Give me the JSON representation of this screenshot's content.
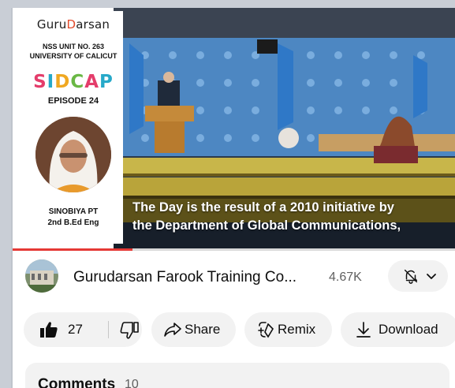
{
  "thumbnail": {
    "brand_prefix": "Guru",
    "brand_dot": "D",
    "brand_suffix": "arsan",
    "unit": "NSS UNIT NO. 263",
    "university": "UNIVERSITY OF CALICUT",
    "series_letters": [
      "S",
      "I",
      "D",
      "C",
      "A",
      "P"
    ],
    "episode": "EPISODE 24",
    "presenter_name": "SINOBIYA PT",
    "presenter_class": "2nd B.Ed Eng"
  },
  "video": {
    "caption_line1": "The Day is the result of a 2010 initiative by",
    "caption_line2": "the Department of Global Communications,",
    "progress": 0.27
  },
  "channel": {
    "name": "Gurudarsan Farook Training Co...",
    "subscribers": "4.67K",
    "bell_icon": "bell-off-icon",
    "dropdown_icon": "chevron-down-icon"
  },
  "actions": {
    "like_count": "27",
    "share_label": "Share",
    "remix_label": "Remix",
    "download_label": "Download"
  },
  "comments": {
    "title": "Comments",
    "count": "10"
  },
  "colors": {
    "progress": "#e53935",
    "pill_bg": "#f2f2f2",
    "un_blue": "#5b9bd5"
  }
}
